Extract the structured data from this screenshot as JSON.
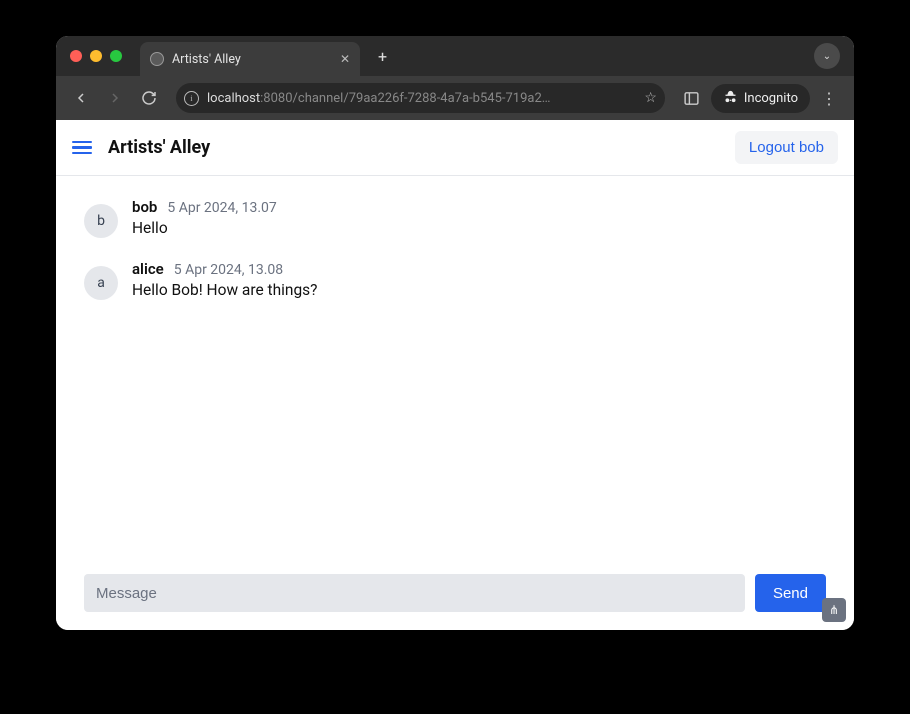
{
  "browser": {
    "tab_title": "Artists' Alley",
    "url_host": "localhost",
    "url_port_path": ":8080/channel/79aa226f-7288-4a7a-b545-719a2…",
    "incognito_label": "Incognito"
  },
  "header": {
    "title": "Artists' Alley",
    "logout_label": "Logout bob"
  },
  "messages": [
    {
      "avatar_letter": "b",
      "author": "bob",
      "timestamp": "5 Apr 2024, 13.07",
      "text": "Hello"
    },
    {
      "avatar_letter": "a",
      "author": "alice",
      "timestamp": "5 Apr 2024, 13.08",
      "text": "Hello Bob! How are things?"
    }
  ],
  "composer": {
    "placeholder": "Message",
    "send_label": "Send"
  }
}
